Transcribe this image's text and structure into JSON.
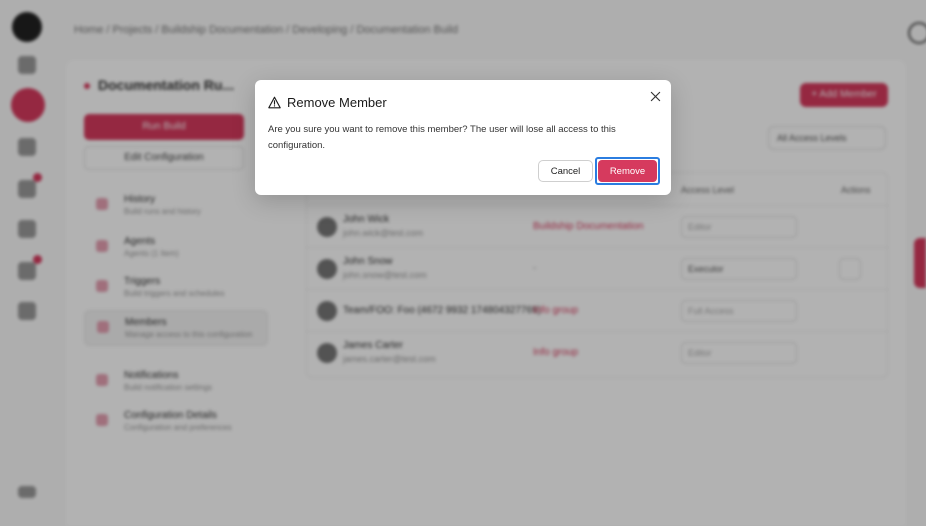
{
  "app": {
    "breadcrumb": "Home / Projects / Buildship Documentation / Developing / Documentation Build",
    "config_title": "Documentation Ru...",
    "run_label": "Run Build",
    "edit_label": "Edit Configuration",
    "nav": [
      {
        "title": "History",
        "sub": "Build runs and history"
      },
      {
        "title": "Agents",
        "sub": "Agents (1 Item)"
      },
      {
        "title": "Triggers",
        "sub": "Build triggers and schedules"
      },
      {
        "title": "Members",
        "sub": "Manage access to this configuration"
      },
      {
        "title": "Notifications",
        "sub": "Build notification settings"
      },
      {
        "title": "Configuration Details",
        "sub": "Configuration and preferences"
      }
    ],
    "add_member_label": "+ Add Member",
    "filter_label": "All Access Levels",
    "table": {
      "headers": [
        "Access Level",
        "Actions"
      ],
      "rows": [
        {
          "name": "John Wick",
          "email": "john.wick@test.com",
          "source": "Buildship Documentation",
          "level": "Editor"
        },
        {
          "name": "John Snow",
          "email": "john.snow@test.com",
          "source": "-",
          "level": "Executor"
        },
        {
          "name": "Team/FOO: Foo (4672 9932 174804327769)",
          "email": "",
          "source": "Info group",
          "level": "Full Access"
        },
        {
          "name": "James Carter",
          "email": "james.carter@test.com",
          "source": "Info group",
          "level": "Editor"
        }
      ]
    }
  },
  "dialog": {
    "title": "Remove Member",
    "body": "Are you sure you want to remove this member? The user will lose all access to this configuration.",
    "cancel_label": "Cancel",
    "remove_label": "Remove",
    "accent_color": "#d63a5e",
    "focus_color": "#2b7de0",
    "title_icon": "warning-icon",
    "close_icon": "close-icon"
  }
}
